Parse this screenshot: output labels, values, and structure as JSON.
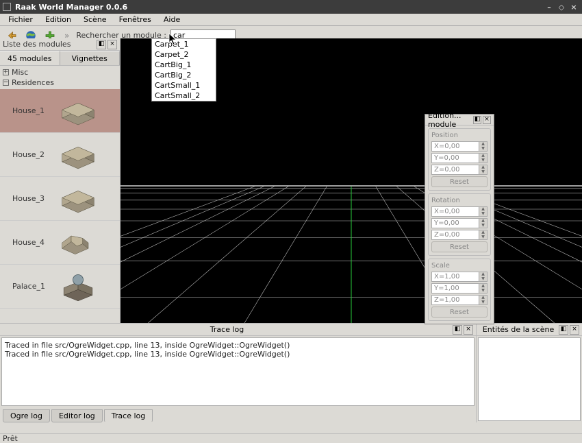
{
  "window": {
    "title": "Raak World Manager 0.0.6"
  },
  "menu": {
    "items": [
      "Fichier",
      "Edition",
      "Scène",
      "Fenêtres",
      "Aide"
    ]
  },
  "toolbar": {
    "search_label": "Rechercher un module :",
    "search_value": "car"
  },
  "autocomplete": {
    "items": [
      "Carpet_1",
      "Carpet_2",
      "CartBig_1",
      "CartBig_2",
      "CartSmall_1",
      "CartSmall_2"
    ]
  },
  "modules_panel": {
    "title": "Liste des modules",
    "tabs": {
      "count": "45 modules",
      "thumbs": "Vignettes"
    },
    "tree": {
      "nodes": [
        {
          "exp": "+",
          "label": "Misc"
        },
        {
          "exp": "−",
          "label": "Residences"
        }
      ]
    },
    "list": [
      {
        "label": "House_1",
        "selected": true,
        "kind": "house1"
      },
      {
        "label": "House_2",
        "selected": false,
        "kind": "house2"
      },
      {
        "label": "House_3",
        "selected": false,
        "kind": "house3"
      },
      {
        "label": "House_4",
        "selected": false,
        "kind": "house4"
      },
      {
        "label": "Palace_1",
        "selected": false,
        "kind": "palace"
      }
    ]
  },
  "edit_panel": {
    "title": "Edition... module",
    "groups": [
      {
        "name": "Position",
        "fields": [
          "X=0,00",
          "Y=0,00",
          "Z=0,00"
        ],
        "reset": "Reset"
      },
      {
        "name": "Rotation",
        "fields": [
          "X=0,00",
          "Y=0,00",
          "Z=0,00"
        ],
        "reset": "Reset"
      },
      {
        "name": "Scale",
        "fields": [
          "X=1,00",
          "Y=1,00",
          "Z=1,00"
        ],
        "reset": "Reset"
      }
    ]
  },
  "trace": {
    "title": "Trace log",
    "lines": [
      "Traced in file src/OgreWidget.cpp, line 13, inside OgreWidget::OgreWidget()",
      "Traced in file src/OgreWidget.cpp, line 13, inside OgreWidget::OgreWidget()"
    ],
    "tabs": [
      "Ogre log",
      "Editor log",
      "Trace log"
    ]
  },
  "entities": {
    "title": "Entités de la scène"
  },
  "status": {
    "text": "Prêt"
  }
}
